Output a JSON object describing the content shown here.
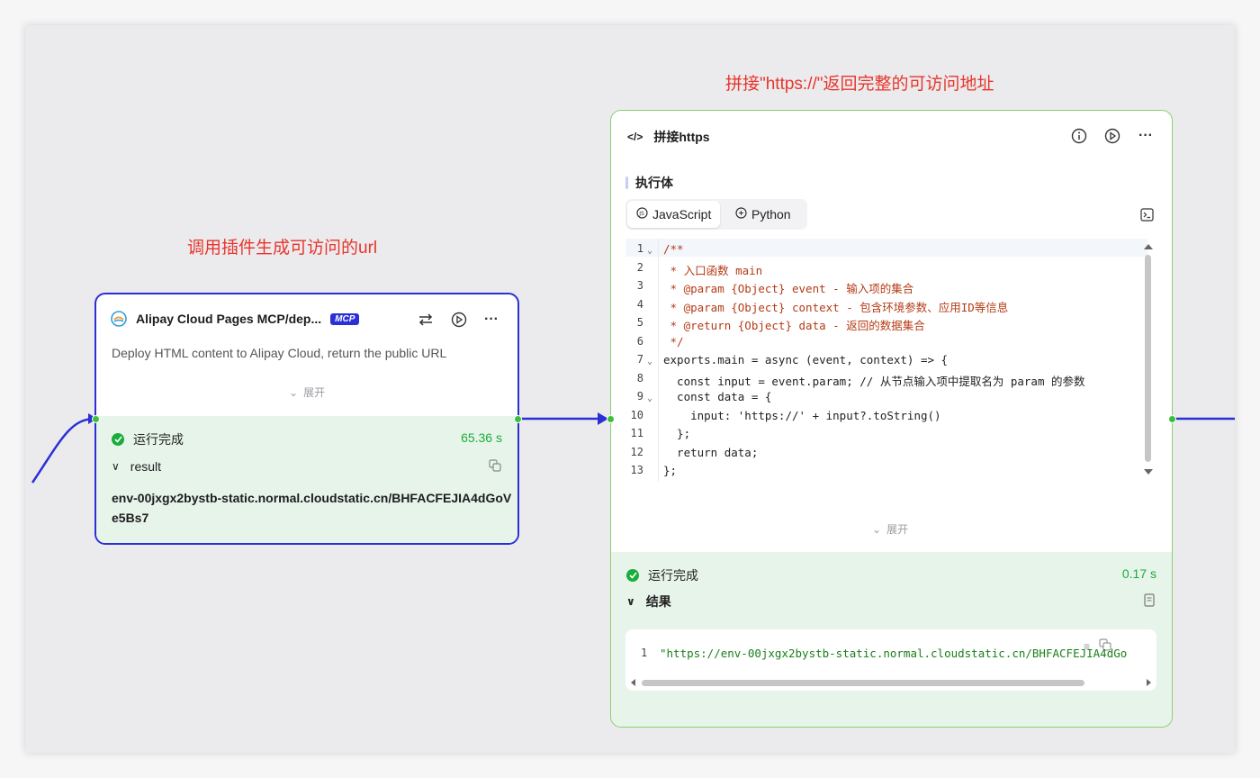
{
  "annotations": {
    "left": "调用插件生成可访问的url",
    "right": "拼接\"https://\"返回完整的可访问地址"
  },
  "node1": {
    "title": "Alipay Cloud Pages MCP/dep...",
    "badge": "MCP",
    "description": "Deploy HTML content to Alipay Cloud, return the public URL",
    "expand": "展开",
    "status": "运行完成",
    "time": "65.36 s",
    "output_label": "result",
    "output_value_line1": "env-00jxgx2bystb-static.normal.cloudstatic.cn/BHFACFEJIA4dGoV",
    "output_value_line2": "e5Bs7"
  },
  "node2": {
    "title": "拼接https",
    "section": "执行体",
    "tabs": [
      "JavaScript",
      "Python"
    ],
    "active_tab": "JavaScript",
    "code_lines": [
      "/**",
      " * 入口函数 main",
      " * @param {Object} event - 输入项的集合",
      " * @param {Object} context - 包含环境参数、应用ID等信息",
      " * @return {Object} data - 返回的数据集合",
      " */",
      "exports.main = async (event, context) => {",
      "  const input = event.param; // 从节点输入项中提取名为 param 的参数",
      "  const data = {",
      "    input: 'https://' + input?.toString()",
      "  };",
      "  return data;",
      "};"
    ],
    "line_numbers": [
      "1",
      "2",
      "3",
      "4",
      "5",
      "6",
      "7",
      "8",
      "9",
      "10",
      "11",
      "12",
      "13"
    ],
    "expand": "展开",
    "status": "运行完成",
    "time": "0.17 s",
    "output_label": "结果",
    "result_line_no": "1",
    "result_value": "\"https://env-00jxgx2bystb-static.normal.cloudstatic.cn/BHFACFEJIA4dGo"
  }
}
